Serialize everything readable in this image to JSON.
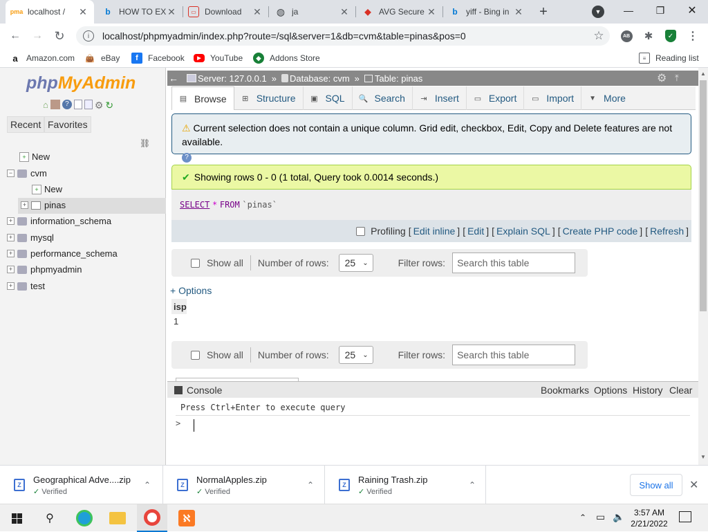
{
  "browser": {
    "tabs": [
      {
        "title": "localhost / ",
        "icon": "phpmyadmin-icon",
        "active": true
      },
      {
        "title": "HOW TO EX",
        "icon": "bing-icon"
      },
      {
        "title": "Download",
        "icon": "download-site-icon"
      },
      {
        "title": "ja",
        "icon": "globe-icon"
      },
      {
        "title": "AVG Secure",
        "icon": "avg-icon"
      },
      {
        "title": "yiff - Bing in",
        "icon": "bing-icon"
      }
    ],
    "url": "localhost/phpmyadmin/index.php?route=/sql&server=1&db=cvm&table=pinas&pos=0",
    "bookmarks": [
      "Amazon.com",
      "eBay",
      "Facebook",
      "YouTube",
      "Addons Store"
    ],
    "reading_list": "Reading list"
  },
  "pma": {
    "logo_a": "php",
    "logo_b": "MyAdmin",
    "nav_tabs": {
      "recent": "Recent",
      "favorites": "Favorites"
    },
    "tree": [
      {
        "label": "New",
        "level": 0
      },
      {
        "label": "cvm",
        "level": 0
      },
      {
        "label": "New",
        "level": 1
      },
      {
        "label": "pinas",
        "level": 1
      },
      {
        "label": "information_schema",
        "level": 0
      },
      {
        "label": "mysql",
        "level": 0
      },
      {
        "label": "performance_schema",
        "level": 0
      },
      {
        "label": "phpmyadmin",
        "level": 0
      },
      {
        "label": "test",
        "level": 0
      }
    ],
    "breadcrumb": {
      "server": "Server: 127.0.0.1",
      "database": "Database: cvm",
      "table": "Table: pinas",
      "sep": "»"
    },
    "tabs": [
      "Browse",
      "Structure",
      "SQL",
      "Search",
      "Insert",
      "Export",
      "Import",
      "More"
    ],
    "warning": "Current selection does not contain a unique column. Grid edit, checkbox, Edit, Copy and Delete features are not available.",
    "success": "Showing rows 0 - 0 (1 total, Query took 0.0014 seconds.)",
    "sql": {
      "kw1": "SELECT",
      "star": "*",
      "kw2": "FROM",
      "table": "`pinas`"
    },
    "profiling": {
      "label": "Profiling",
      "links": [
        "Edit inline",
        "Edit",
        "Explain SQL",
        "Create PHP code",
        "Refresh"
      ]
    },
    "filter": {
      "show_all": "Show all",
      "num_rows_label": "Number of rows:",
      "num_rows": "25",
      "filter_label": "Filter rows:",
      "placeholder": "Search this table"
    },
    "options": "+ Options",
    "result": {
      "column": "isp",
      "value": "1"
    },
    "console": {
      "title": "Console",
      "actions": [
        "Bookmarks",
        "Options",
        "History",
        "Clear"
      ],
      "hint": "Press Ctrl+Enter to execute query",
      "prompt": ">"
    }
  },
  "downloads": [
    {
      "name": "Geographical Adve....zip",
      "status": "Verified"
    },
    {
      "name": "NormalApples.zip",
      "status": "Verified"
    },
    {
      "name": "Raining Trash.zip",
      "status": "Verified"
    }
  ],
  "downloads_show_all": "Show all",
  "taskbar": {
    "time": "3:57 AM",
    "date": "2/21/2022"
  },
  "colors": {
    "accent": "#235a81",
    "success_bg": "#ebf8a4",
    "notice_bg": "#e8eef1"
  }
}
